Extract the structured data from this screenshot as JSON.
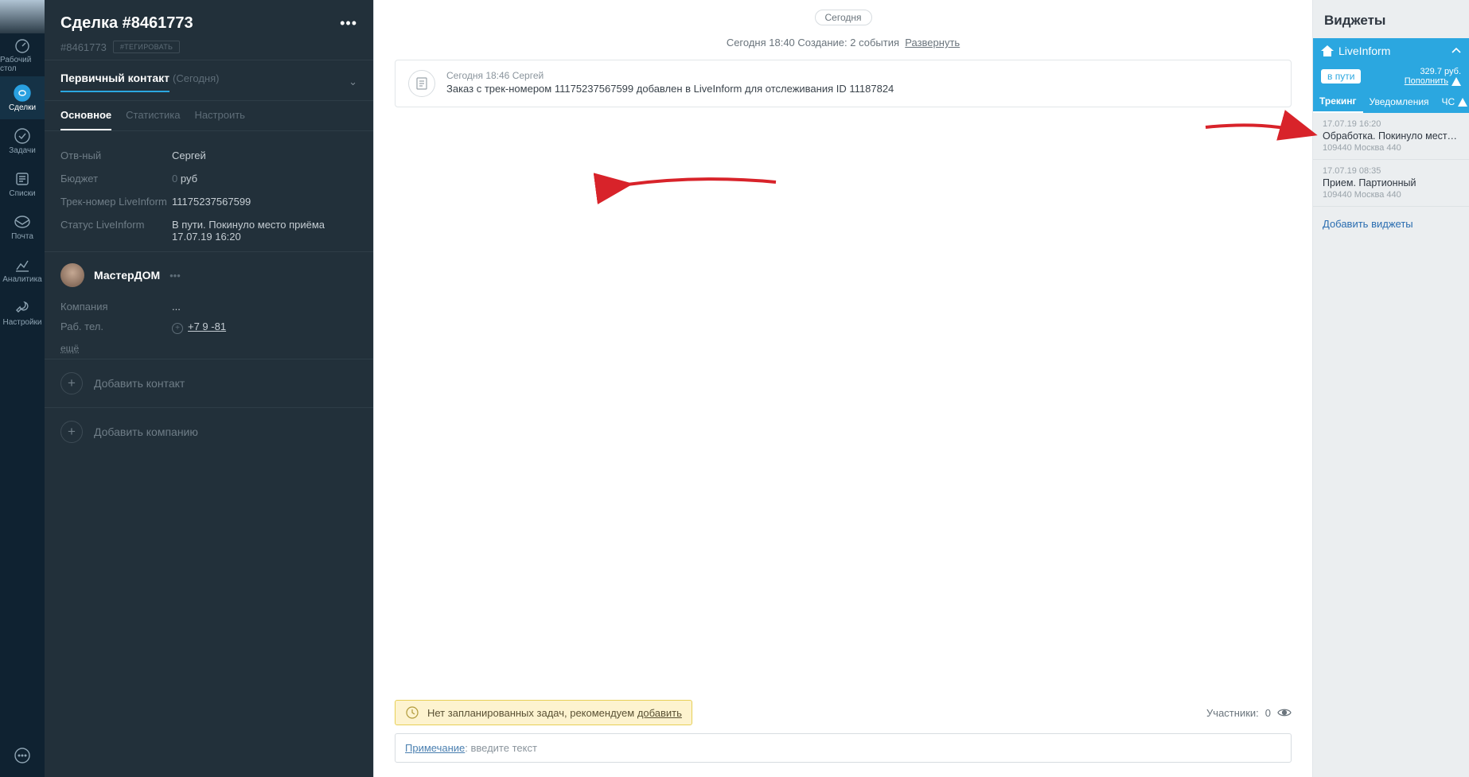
{
  "rail": {
    "items": [
      {
        "label": "Рабочий стол"
      },
      {
        "label": "Сделки"
      },
      {
        "label": "Задачи"
      },
      {
        "label": "Списки"
      },
      {
        "label": "Почта"
      },
      {
        "label": "Аналитика"
      },
      {
        "label": "Настройки"
      }
    ]
  },
  "deal": {
    "title": "Сделка #8461773",
    "id": "#8461773",
    "tag_button": "#ТЕГИРОВАТЬ",
    "primary_contact": {
      "label": "Первичный контакт",
      "muted": "(Сегодня)"
    },
    "tabs": [
      {
        "label": "Основное"
      },
      {
        "label": "Статистика"
      },
      {
        "label": "Настроить"
      }
    ],
    "fields": {
      "responsible": {
        "label": "Отв-ный",
        "value": "Сергей"
      },
      "budget": {
        "label": "Бюджет",
        "value_num": "0",
        "value_unit": "руб"
      },
      "track": {
        "label": "Трек-номер LiveInform",
        "value": "11175237567599"
      },
      "status": {
        "label": "Статус LiveInform",
        "value": "В пути. Покинуло место приёма 17.07.19 16:20"
      }
    },
    "contact": {
      "name": "МастерДОМ",
      "company_label": "Компания",
      "company_value": "...",
      "phone_label": "Раб. тел.",
      "phone_value": "+7 9               -81",
      "more": "ещё"
    },
    "add_contact": "Добавить контакт",
    "add_company": "Добавить компанию"
  },
  "feed": {
    "today_chip": "Сегодня",
    "summary_time": "Сегодня 18:40",
    "summary_text": "Создание: 2 события",
    "summary_expand": "Развернуть",
    "card": {
      "meta": "Сегодня 18:46 Сергей",
      "msg": "Заказ с трек-номером 11175237567599 добавлен в LiveInform для отслеживания ID 11187824"
    },
    "tasks_text": "Нет запланированных задач, рекомендуем ",
    "tasks_link": "добавить",
    "participants_label": "Участники:",
    "participants_count": "0",
    "note_label": "Примечание",
    "note_placeholder": ": введите текст"
  },
  "widgets": {
    "title": "Виджеты",
    "liveinform": {
      "brand": "LiveInform",
      "badge": "в пути",
      "balance": "329.7 руб.",
      "topup": "Пополнить",
      "tabs": [
        {
          "label": "Трекинг"
        },
        {
          "label": "Уведомления"
        },
        {
          "label": "ЧС"
        }
      ],
      "events": [
        {
          "ts": "17.07.19 16:20",
          "title": "Обработка. Покинуло место приёма",
          "loc": "109440 Москва 440"
        },
        {
          "ts": "17.07.19 08:35",
          "title": "Прием. Партионный",
          "loc": "109440 Москва 440"
        }
      ]
    },
    "add": "Добавить виджеты"
  }
}
